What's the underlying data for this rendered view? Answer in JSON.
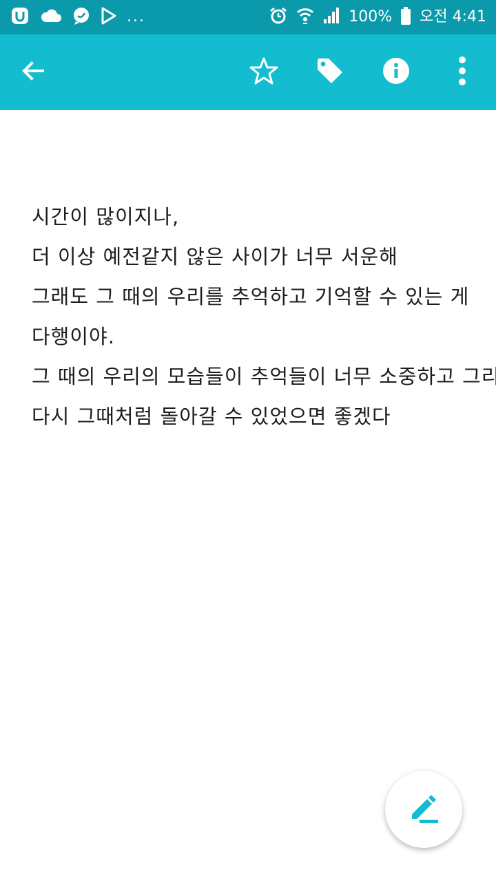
{
  "status_bar": {
    "notification_icons": [
      "u-plus-icon",
      "cloud-icon",
      "chat-bubble-icon",
      "play-store-icon"
    ],
    "more_indicator": "...",
    "battery": "100%",
    "time": "오전 4:41"
  },
  "toolbar": {
    "back_icon": "arrow-left-icon",
    "favorite_icon": "star-outline-icon",
    "tag_icon": "tag-icon",
    "info_icon": "info-icon",
    "overflow_icon": "more-vert-icon",
    "color": "#13bccf"
  },
  "note": {
    "lines": [
      "시간이 많이지나,",
      "더 이상 예전같지 않은 사이가 너무 서운해",
      "그래도 그 때의 우리를 추억하고 기억할 수 있는 게",
      "다행이야.",
      "그 때의 우리의 모습들이 추억들이 너무 소중하고 그리워",
      "다시 그때처럼 돌아갈 수 있었으면 좋겠다"
    ]
  },
  "fab": {
    "icon": "pencil-edit-icon",
    "accent": "#13bccf"
  }
}
